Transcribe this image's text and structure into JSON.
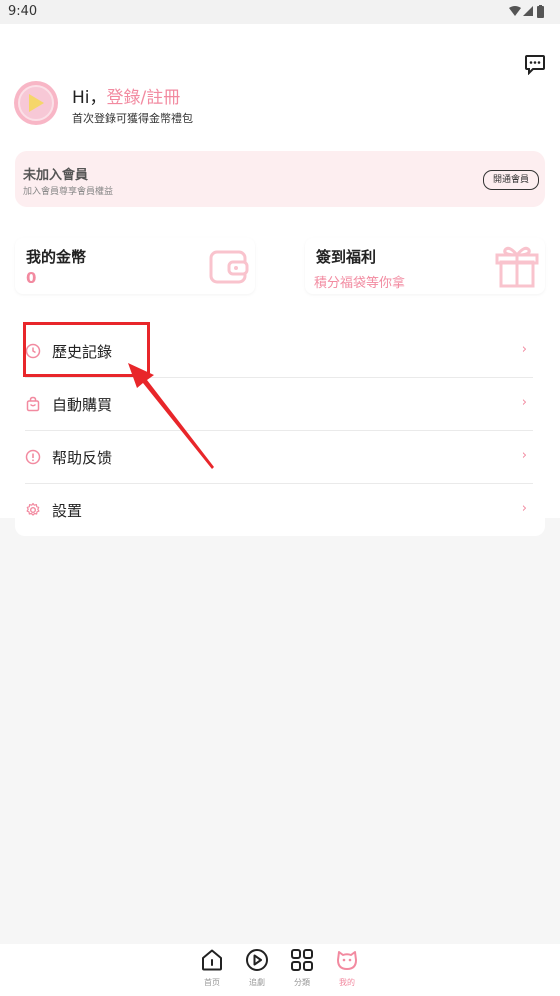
{
  "status": {
    "time": "9:40"
  },
  "profile": {
    "greeting": "Hi，",
    "login_link": "登錄/註冊",
    "subtitle": "首次登錄可獲得金幣禮包"
  },
  "vip": {
    "title": "未加入會員",
    "subtitle": "加入會員尊享會員權益",
    "button": "開通會員"
  },
  "coins": {
    "title": "我的金幣",
    "value": "0"
  },
  "checkin": {
    "title": "簽到福利",
    "subtitle": "積分福袋等你拿"
  },
  "menu": [
    {
      "label": "歷史記錄",
      "icon": "clock-icon"
    },
    {
      "label": "自動購買",
      "icon": "bag-icon"
    },
    {
      "label": "帮助反馈",
      "icon": "alert-icon"
    },
    {
      "label": "設置",
      "icon": "gear-icon"
    }
  ],
  "menu_arrow": "›",
  "nav": [
    {
      "label": "首页",
      "icon": "home-icon"
    },
    {
      "label": "追劇",
      "icon": "play-circle-icon"
    },
    {
      "label": "分類",
      "icon": "grid-icon"
    },
    {
      "label": "我的",
      "icon": "face-icon"
    }
  ],
  "colors": {
    "accent": "#f28aa0",
    "highlight": "#e8262a",
    "vip_bg": "#fdeef0"
  }
}
